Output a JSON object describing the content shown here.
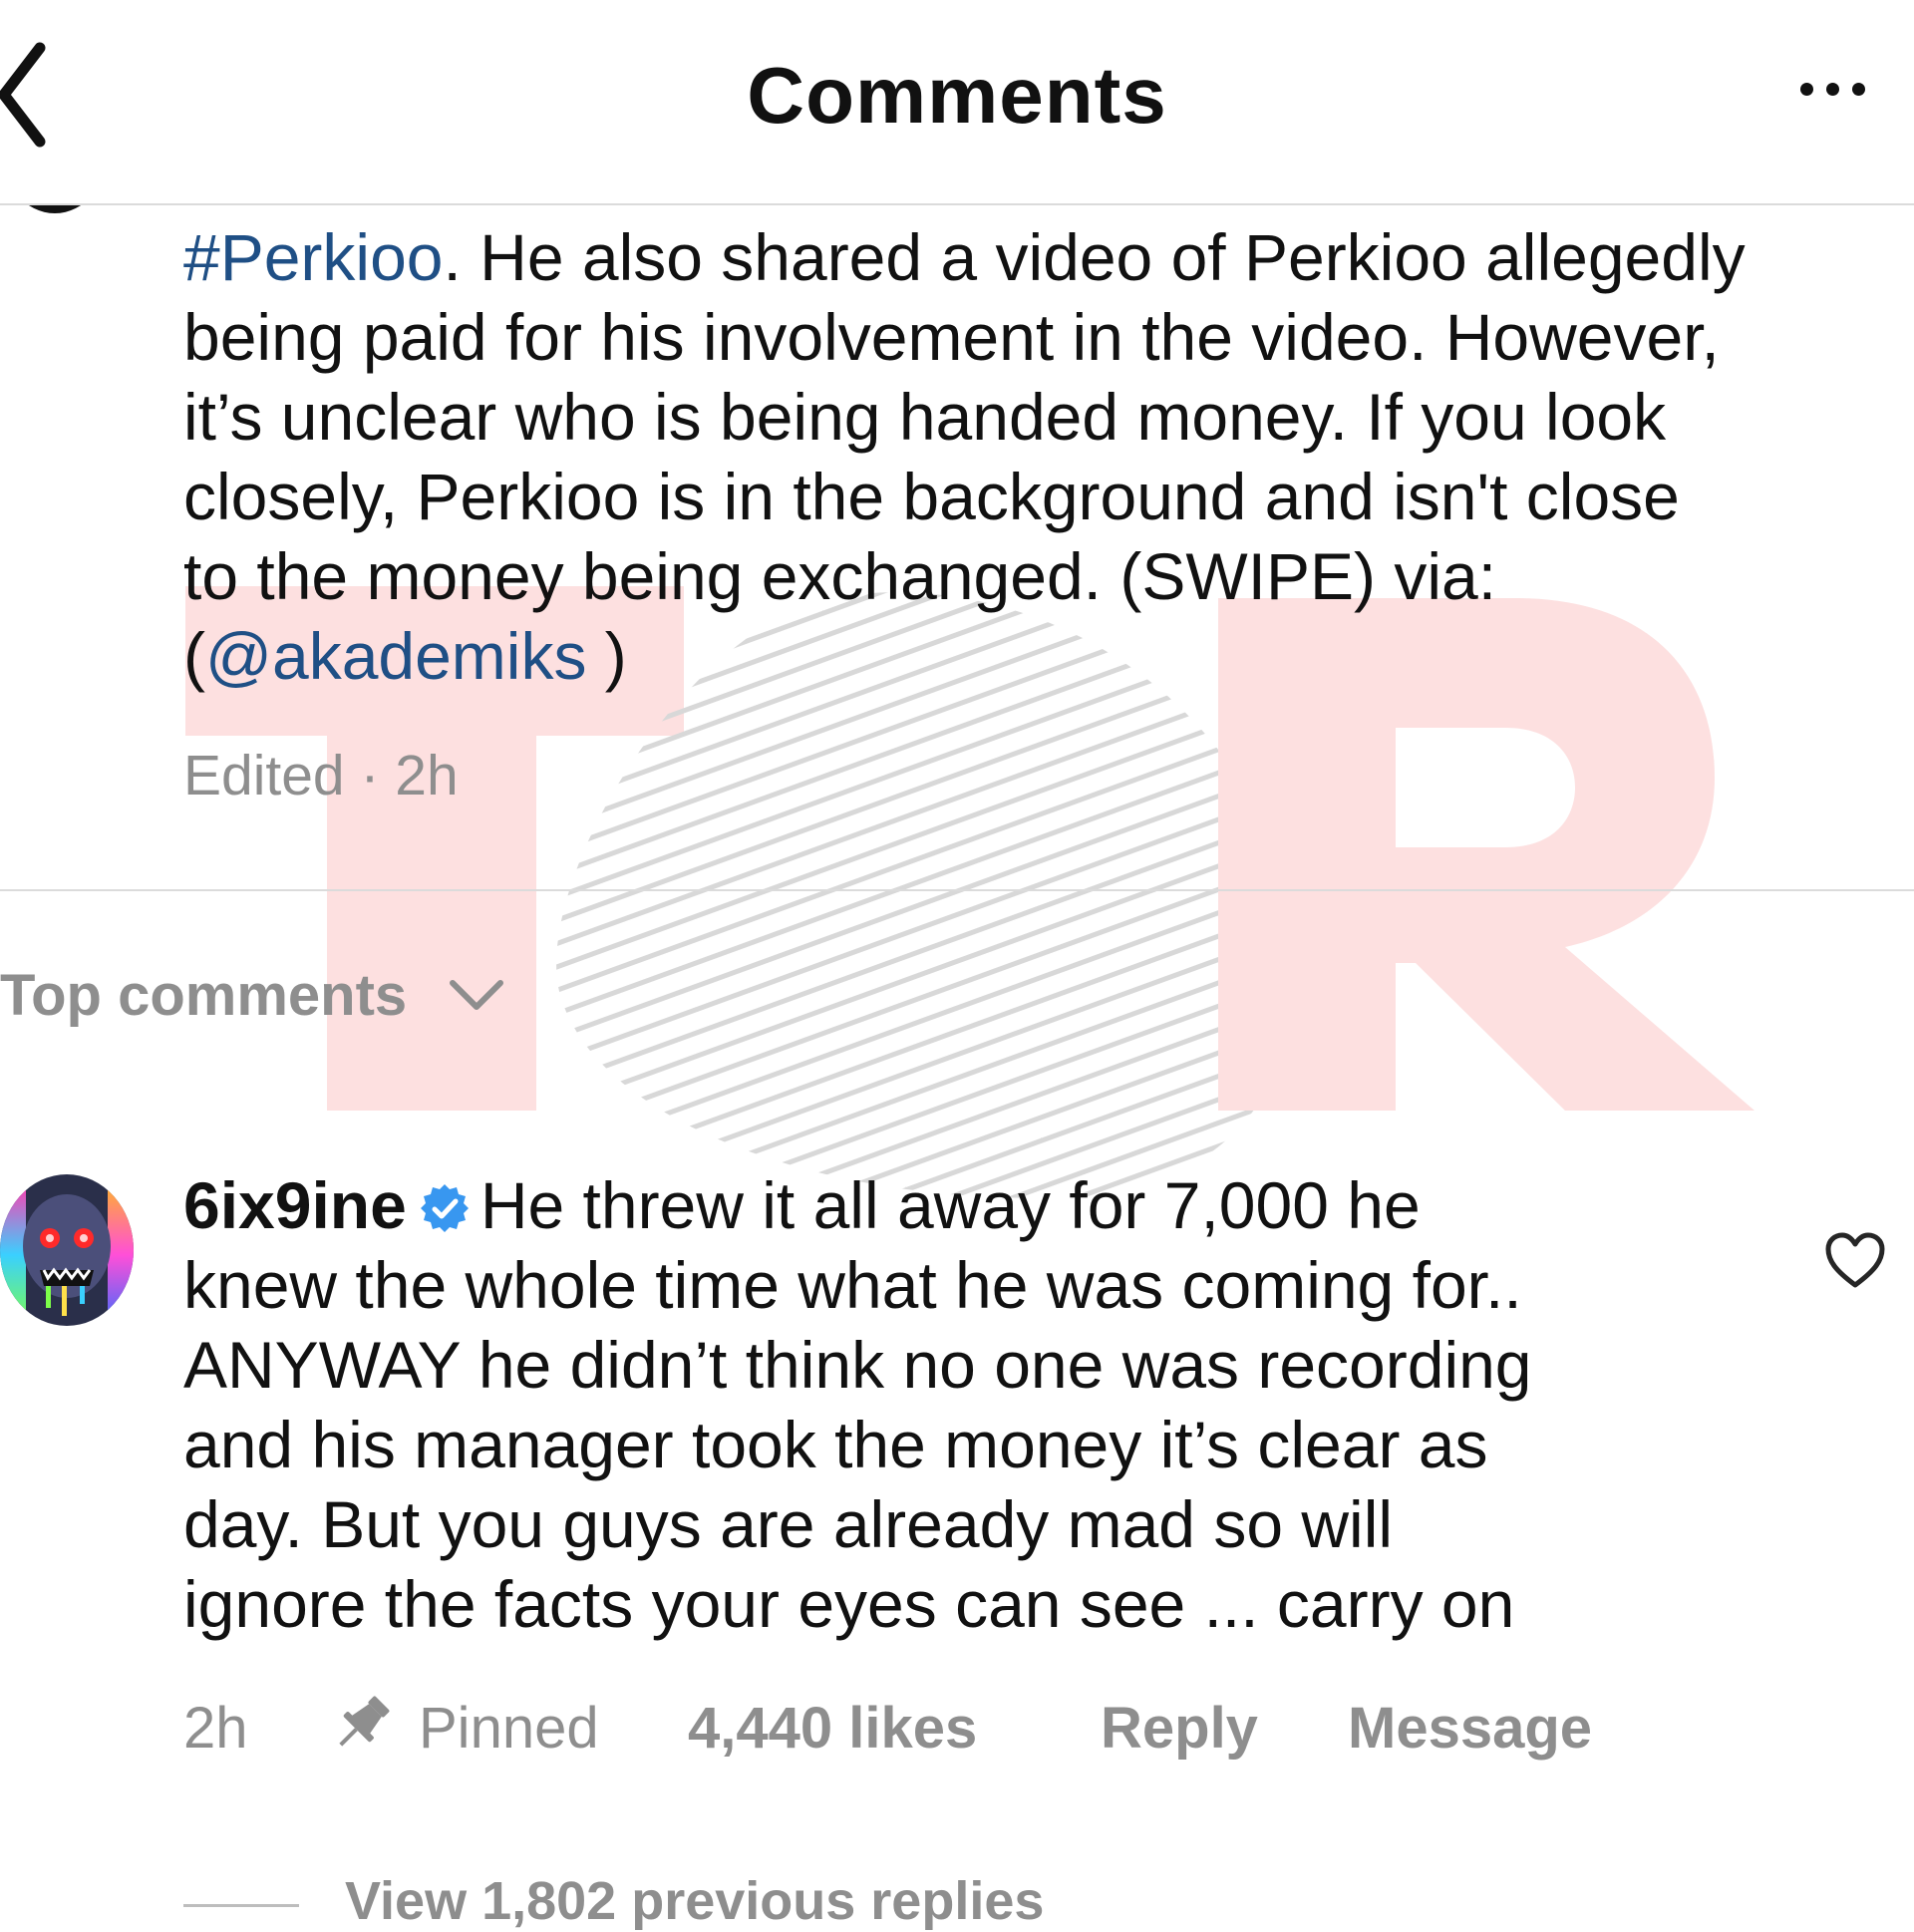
{
  "header": {
    "title": "Comments",
    "back_icon": "chevron-left-icon",
    "more_icon": "ellipsis-icon"
  },
  "post": {
    "caption_lines": [
      {
        "link": "#Perkioo",
        "text": ". He also shared a video of Perkioo allegedly"
      },
      {
        "text": "being paid for his involvement in the video. However,"
      },
      {
        "text": "it’s unclear who is being handed money. If you look"
      },
      {
        "text": "closely, Perkioo is in the background and isn't close"
      },
      {
        "text": "to the money being exchanged. (SWIPE) via:"
      },
      {
        "pre": "(",
        "link": "@akademiks",
        "text": " )"
      }
    ],
    "meta": "Edited · 2h"
  },
  "sort": {
    "label": "Top comments",
    "icon": "chevron-down-icon"
  },
  "comment": {
    "username": "6ix9ine",
    "verified_icon": "verified-badge-icon",
    "lines": [
      "He threw it all away for 7,000 he",
      "knew the whole time what he was coming for..",
      "ANYWAY he didn’t think no one was recording",
      "and his manager took the money it’s clear as",
      "day. But you guys are already mad so will",
      "ignore the facts your eyes can see ... carry on"
    ],
    "time": "2h",
    "pinned": "Pinned",
    "likes": "4,440 likes",
    "reply": "Reply",
    "message": "Message",
    "view_replies": "View 1,802 previous replies"
  },
  "colors": {
    "link": "#1f4f85",
    "muted": "#8e8e8e",
    "verified": "#3897f0",
    "watermark": "#fde0e0"
  }
}
